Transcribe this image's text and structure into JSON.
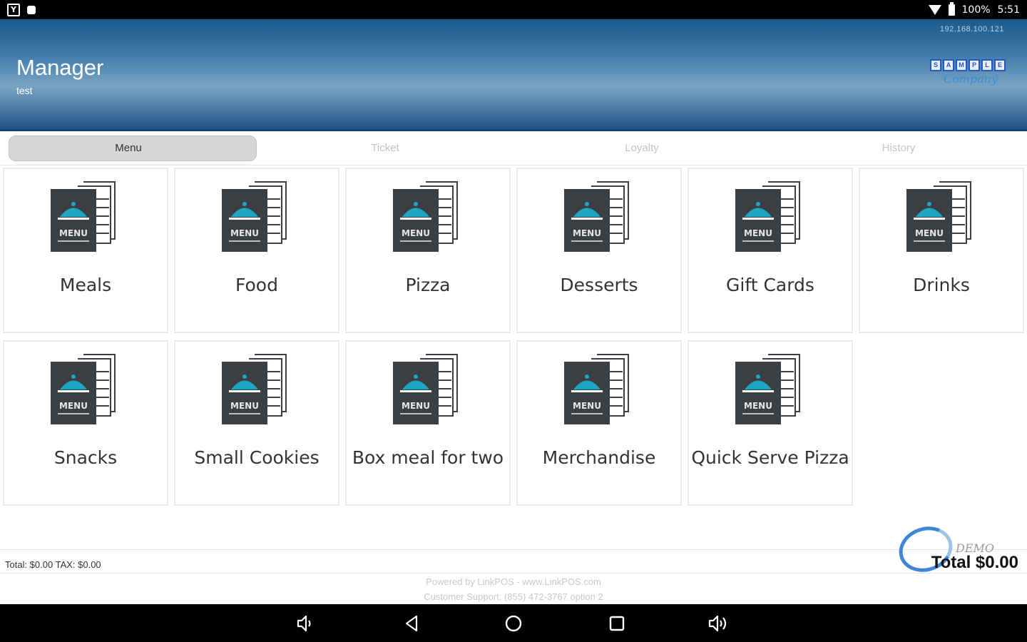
{
  "status_bar": {
    "battery": "100%",
    "time": "5:51"
  },
  "header": {
    "title": "Manager",
    "subtitle": "test",
    "ip_address": "192.168.100.121",
    "logo_letters": [
      "S",
      "A",
      "M",
      "P",
      "L",
      "E"
    ],
    "logo_word": "Company"
  },
  "tabs": [
    {
      "label": "Menu",
      "active": true
    },
    {
      "label": "Ticket",
      "active": false
    },
    {
      "label": "Loyalty",
      "active": false
    },
    {
      "label": "History",
      "active": false
    }
  ],
  "menu_tiles": [
    {
      "label": "Meals",
      "icon": "menu-book-icon"
    },
    {
      "label": "Food",
      "icon": "menu-book-icon"
    },
    {
      "label": "Pizza",
      "icon": "menu-book-icon"
    },
    {
      "label": "Desserts",
      "icon": "menu-book-icon"
    },
    {
      "label": "Gift Cards",
      "icon": "menu-book-icon"
    },
    {
      "label": "Drinks",
      "icon": "menu-book-icon"
    },
    {
      "label": "Snacks",
      "icon": "menu-book-icon"
    },
    {
      "label": "Small Cookies",
      "icon": "menu-book-icon"
    },
    {
      "label": "Box meal for two",
      "icon": "menu-book-icon"
    },
    {
      "label": "Merchandise",
      "icon": "menu-book-icon"
    },
    {
      "label": "Quick Serve Pizza",
      "icon": "menu-book-icon"
    }
  ],
  "icon_text": "MENU",
  "totals": {
    "summary": "Total: $0.00  TAX: $0.00",
    "grand_total": "Total $0.00",
    "demo_word": "DEMO"
  },
  "footer": {
    "powered_by": "Powered by LinkPOS - www.LinkPOS.com",
    "support": "Customer Support: (855) 472-3767 option 2"
  },
  "colors": {
    "header_top": "#1a5a8c",
    "header_mid": "#7aa4c4",
    "icon_dark": "#3b3f44",
    "icon_accent": "#1aa7bf",
    "tab_active_bg": "#d6d6d6"
  },
  "nav_bar": {
    "buttons": [
      "volume-down-icon",
      "back-icon",
      "home-icon",
      "recents-icon",
      "volume-up-icon"
    ]
  }
}
